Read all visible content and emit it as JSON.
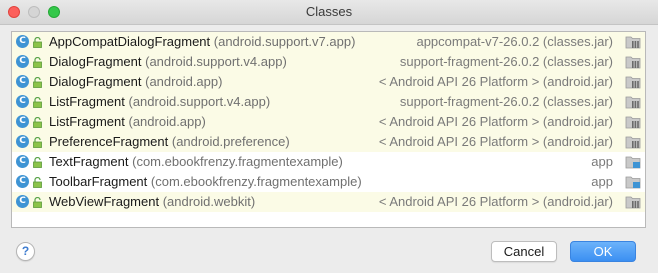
{
  "window": {
    "title": "Classes"
  },
  "rows": [
    {
      "class": "AppCompatDialogFragment",
      "package": "(android.support.v7.app)",
      "source": "appcompat-v7-26.0.2 (classes.jar)",
      "kind": "library"
    },
    {
      "class": "DialogFragment",
      "package": "(android.support.v4.app)",
      "source": "support-fragment-26.0.2 (classes.jar)",
      "kind": "library"
    },
    {
      "class": "DialogFragment",
      "package": "(android.app)",
      "source": "< Android API 26 Platform > (android.jar)",
      "kind": "library"
    },
    {
      "class": "ListFragment",
      "package": "(android.support.v4.app)",
      "source": "support-fragment-26.0.2 (classes.jar)",
      "kind": "library"
    },
    {
      "class": "ListFragment",
      "package": "(android.app)",
      "source": "< Android API 26 Platform > (android.jar)",
      "kind": "library"
    },
    {
      "class": "PreferenceFragment",
      "package": "(android.preference)",
      "source": "< Android API 26 Platform > (android.jar)",
      "kind": "library"
    },
    {
      "class": "TextFragment",
      "package": "(com.ebookfrenzy.fragmentexample)",
      "source": "app",
      "kind": "project"
    },
    {
      "class": "ToolbarFragment",
      "package": "(com.ebookfrenzy.fragmentexample)",
      "source": "app",
      "kind": "project"
    },
    {
      "class": "WebViewFragment",
      "package": "(android.webkit)",
      "source": "< Android API 26 Platform > (android.jar)",
      "kind": "library"
    }
  ],
  "row_icon": {
    "letter": "C",
    "name": "class-icon"
  },
  "buttons": {
    "help": "?",
    "cancel": "Cancel",
    "ok": "OK"
  },
  "colors": {
    "library_row_bg": "#fbfbe6",
    "project_row_bg": "#ffffff",
    "class_icon": "#3e94d4",
    "ok_button": "#3b8ff2"
  }
}
